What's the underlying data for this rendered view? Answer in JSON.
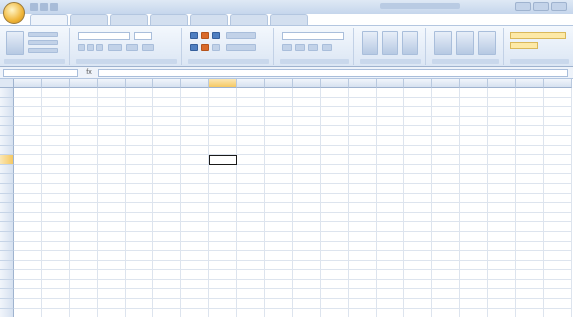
{
  "app": {
    "title": ""
  },
  "ribbon": {
    "tabs": [
      {
        "label": "",
        "active": true
      },
      {
        "label": "",
        "active": false
      },
      {
        "label": "",
        "active": false
      },
      {
        "label": "",
        "active": false
      },
      {
        "label": "",
        "active": false
      },
      {
        "label": "",
        "active": false
      },
      {
        "label": "",
        "active": false
      }
    ],
    "group_labels": [
      "",
      "",
      "",
      "",
      "",
      "",
      ""
    ],
    "font_name": "",
    "number_format": ""
  },
  "formula_bar": {
    "name_box": "",
    "fx_label": "fx",
    "value": ""
  },
  "sheet": {
    "columns": [
      "",
      "",
      "",
      "",
      "",
      "",
      "",
      "",
      "",
      "",
      "",
      "",
      "",
      "",
      "",
      "",
      "",
      "",
      "",
      ""
    ],
    "selected_column": 7,
    "selected_row": 7,
    "active_cell": {
      "row": 7,
      "col": 7
    },
    "rows": [
      {
        "label": "",
        "cells": [
          "",
          "",
          "",
          "",
          "",
          "",
          "",
          "",
          "",
          "",
          "",
          "",
          "",
          "",
          "",
          "",
          "",
          "",
          "",
          ""
        ]
      },
      {
        "label": "",
        "cells": [
          "",
          "",
          "",
          "",
          "",
          "",
          "",
          "",
          "",
          "",
          "",
          "",
          "",
          "",
          "",
          "",
          "",
          "",
          "",
          ""
        ]
      },
      {
        "label": "",
        "cells": [
          "",
          "",
          "",
          "",
          "",
          "",
          "",
          "",
          "",
          "",
          "",
          "",
          "",
          "",
          "",
          "",
          "",
          "",
          "",
          ""
        ]
      },
      {
        "label": "",
        "cells": [
          "",
          "",
          "",
          "",
          "",
          "",
          "",
          "",
          "",
          "",
          "",
          "",
          "",
          "",
          "",
          "",
          "",
          "",
          "",
          ""
        ]
      },
      {
        "label": "",
        "cells": [
          "",
          "",
          "",
          "",
          "",
          "",
          "",
          "",
          "",
          "",
          "",
          "",
          "",
          "",
          "",
          "",
          "",
          "",
          "",
          ""
        ]
      },
      {
        "label": "",
        "cells": [
          "",
          "",
          "",
          "",
          "",
          "",
          "",
          "",
          "",
          "",
          "",
          "",
          "",
          "",
          "",
          "",
          "",
          "",
          "",
          ""
        ]
      },
      {
        "label": "",
        "cells": [
          "",
          "",
          "",
          "",
          "",
          "",
          "",
          "",
          "",
          "",
          "",
          "",
          "",
          "",
          "",
          "",
          "",
          "",
          "",
          ""
        ]
      },
      {
        "label": "",
        "cells": [
          "",
          "",
          "",
          "",
          "",
          "",
          "",
          "",
          "",
          "",
          "",
          "",
          "",
          "",
          "",
          "",
          "",
          "",
          "",
          ""
        ]
      },
      {
        "label": "",
        "cells": [
          "",
          "",
          "",
          "",
          "",
          "",
          "",
          "",
          "",
          "",
          "",
          "",
          "",
          "",
          "",
          "",
          "",
          "",
          "",
          ""
        ]
      },
      {
        "label": "",
        "cells": [
          "",
          "",
          "",
          "",
          "",
          "",
          "",
          "",
          "",
          "",
          "",
          "",
          "",
          "",
          "",
          "",
          "",
          "",
          "",
          ""
        ]
      },
      {
        "label": "",
        "cells": [
          "",
          "",
          "",
          "",
          "",
          "",
          "",
          "",
          "",
          "",
          "",
          "",
          "",
          "",
          "",
          "",
          "",
          "",
          "",
          ""
        ]
      },
      {
        "label": "",
        "cells": [
          "",
          "",
          "",
          "",
          "",
          "",
          "",
          "",
          "",
          "",
          "",
          "",
          "",
          "",
          "",
          "",
          "",
          "",
          "",
          ""
        ]
      },
      {
        "label": "",
        "cells": [
          "",
          "",
          "",
          "",
          "",
          "",
          "",
          "",
          "",
          "",
          "",
          "",
          "",
          "",
          "",
          "",
          "",
          "",
          "",
          ""
        ]
      },
      {
        "label": "",
        "cells": [
          "",
          "",
          "",
          "",
          "",
          "",
          "",
          "",
          "",
          "",
          "",
          "",
          "",
          "",
          "",
          "",
          "",
          "",
          "",
          ""
        ]
      },
      {
        "label": "",
        "cells": [
          "",
          "",
          "",
          "",
          "",
          "",
          "",
          "",
          "",
          "",
          "",
          "",
          "",
          "",
          "",
          "",
          "",
          "",
          "",
          ""
        ]
      },
      {
        "label": "",
        "cells": [
          "",
          "",
          "",
          "",
          "",
          "",
          "",
          "",
          "",
          "",
          "",
          "",
          "",
          "",
          "",
          "",
          "",
          "",
          "",
          ""
        ]
      },
      {
        "label": "",
        "cells": [
          "",
          "",
          "",
          "",
          "",
          "",
          "",
          "",
          "",
          "",
          "",
          "",
          "",
          "",
          "",
          "",
          "",
          "",
          "",
          ""
        ]
      },
      {
        "label": "",
        "cells": [
          "",
          "",
          "",
          "",
          "",
          "",
          "",
          "",
          "",
          "",
          "",
          "",
          "",
          "",
          "",
          "",
          "",
          "",
          "",
          ""
        ]
      },
      {
        "label": "",
        "cells": [
          "",
          "",
          "",
          "",
          "",
          "",
          "",
          "",
          "",
          "",
          "",
          "",
          "",
          "",
          "",
          "",
          "",
          "",
          "",
          ""
        ]
      },
      {
        "label": "",
        "cells": [
          "",
          "",
          "",
          "",
          "",
          "",
          "",
          "",
          "",
          "",
          "",
          "",
          "",
          "",
          "",
          "",
          "",
          "",
          "",
          ""
        ]
      },
      {
        "label": "",
        "cells": [
          "",
          "",
          "",
          "",
          "",
          "",
          "",
          "",
          "",
          "",
          "",
          "",
          "",
          "",
          "",
          "",
          "",
          "",
          "",
          ""
        ]
      },
      {
        "label": "",
        "cells": [
          "",
          "",
          "",
          "",
          "",
          "",
          "",
          "",
          "",
          "",
          "",
          "",
          "",
          "",
          "",
          "",
          "",
          "",
          "",
          ""
        ]
      },
      {
        "label": "",
        "cells": [
          "",
          "",
          "",
          "",
          "",
          "",
          "",
          "",
          "",
          "",
          "",
          "",
          "",
          "",
          "",
          "",
          "",
          "",
          "",
          ""
        ]
      },
      {
        "label": "",
        "cells": [
          "",
          "",
          "",
          "",
          "",
          "",
          "",
          "",
          "",
          "",
          "",
          "",
          "",
          "",
          "",
          "",
          "",
          "",
          "",
          ""
        ]
      }
    ]
  },
  "colors": {
    "accent": "#f5c863",
    "ribbon_blue": "#dbe6f4",
    "office_orange": "#f0b63a",
    "active_border": "#1a1a1a"
  },
  "icons": [
    "office-button-icon",
    "save-icon",
    "undo-icon",
    "redo-icon",
    "paste-icon",
    "bold-icon",
    "italic-icon",
    "underline-icon",
    "fill-color-icon",
    "font-color-icon",
    "align-icon",
    "insert-icon",
    "delete-icon",
    "sort-filter-icon",
    "find-icon"
  ]
}
